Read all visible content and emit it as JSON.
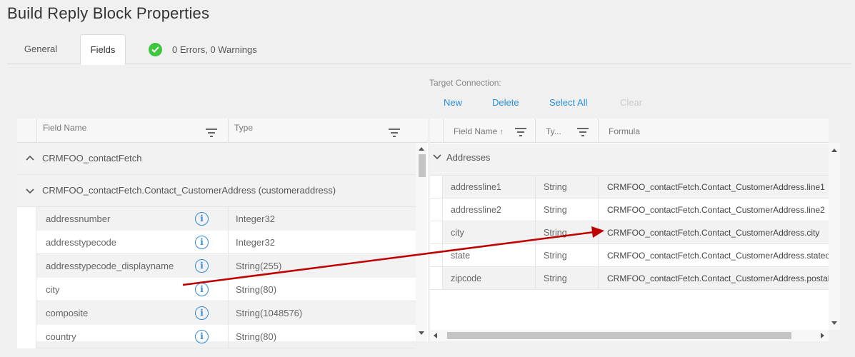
{
  "page": {
    "title": "Build Reply Block Properties"
  },
  "tabs": {
    "general": "General",
    "fields": "Fields"
  },
  "status": {
    "text": "0 Errors, 0 Warnings",
    "color": "#3ec63e"
  },
  "left_grid": {
    "columns": {
      "field_name": "Field Name",
      "type": "Type"
    },
    "groups": [
      {
        "label": "CRMFOO_contactFetch",
        "expanded": true
      },
      {
        "label": "CRMFOO_contactFetch.Contact_CustomerAddress (customeraddress)",
        "expanded": true
      }
    ],
    "rows": [
      {
        "name": "addressnumber",
        "type": "Integer32"
      },
      {
        "name": "addresstypecode",
        "type": "Integer32"
      },
      {
        "name": "addresstypecode_displayname",
        "type": "String(255)"
      },
      {
        "name": "city",
        "type": "String(80)"
      },
      {
        "name": "composite",
        "type": "String(1048576)"
      },
      {
        "name": "country",
        "type": "String(80)"
      }
    ]
  },
  "target": {
    "label": "Target Connection:",
    "actions": {
      "new": "New",
      "delete": "Delete",
      "select_all": "Select All",
      "clear": "Clear"
    },
    "accent": "#2a8fd6"
  },
  "right_grid": {
    "columns": {
      "field_name": "Field Name",
      "type": "Ty...",
      "formula": "Formula"
    },
    "group": {
      "label": "Addresses",
      "expanded": true
    },
    "rows": [
      {
        "name": "addressline1",
        "type": "String",
        "formula": "CRMFOO_contactFetch.Contact_CustomerAddress.line1"
      },
      {
        "name": "addressline2",
        "type": "String",
        "formula": "CRMFOO_contactFetch.Contact_CustomerAddress.line2"
      },
      {
        "name": "city",
        "type": "String",
        "formula": "CRMFOO_contactFetch.Contact_CustomerAddress.city"
      },
      {
        "name": "state",
        "type": "String",
        "formula": "CRMFOO_contactFetch.Contact_CustomerAddress.stateorprovince"
      },
      {
        "name": "zipcode",
        "type": "String",
        "formula": "CRMFOO_contactFetch.Contact_CustomerAddress.postalcode"
      }
    ]
  },
  "annotation": {
    "arrow_color": "#c00000"
  }
}
